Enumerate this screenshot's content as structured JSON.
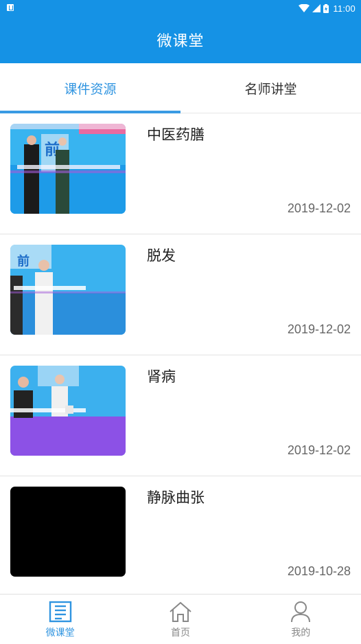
{
  "status_bar": {
    "time": "11:00"
  },
  "header": {
    "title": "微课堂"
  },
  "tabs": [
    {
      "label": "课件资源",
      "active": true
    },
    {
      "label": "名师讲堂",
      "active": false
    }
  ],
  "courses": [
    {
      "title": "中医药膳",
      "date": "2019-12-02"
    },
    {
      "title": "脱发",
      "date": "2019-12-02"
    },
    {
      "title": "肾病",
      "date": "2019-12-02"
    },
    {
      "title": "静脉曲张",
      "date": "2019-10-28"
    }
  ],
  "bottom_nav": [
    {
      "label": "微课堂",
      "icon": "news-icon",
      "active": true
    },
    {
      "label": "首页",
      "icon": "home-icon",
      "active": false
    },
    {
      "label": "我的",
      "icon": "user-icon",
      "active": false
    }
  ],
  "colors": {
    "primary": "#1592e5",
    "active_text": "#2f94e0"
  }
}
